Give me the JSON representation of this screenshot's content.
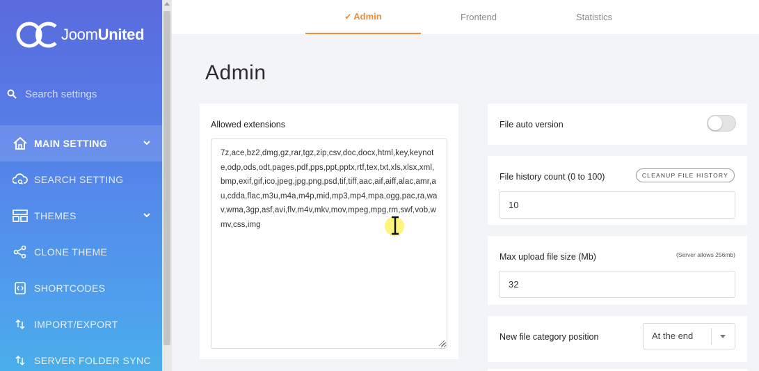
{
  "brand": {
    "logo_light": "Joom",
    "logo_bold": "United"
  },
  "search": {
    "placeholder": "Search settings"
  },
  "sidebar": {
    "items": [
      {
        "label": "MAIN SETTING",
        "icon": "home-icon",
        "active": true,
        "has_chevron": true
      },
      {
        "label": "SEARCH SETTING",
        "icon": "cloud-search-icon",
        "active": false,
        "has_chevron": false
      },
      {
        "label": "THEMES",
        "icon": "layout-icon",
        "active": false,
        "has_chevron": true
      },
      {
        "label": "CLONE THEME",
        "icon": "share-icon",
        "active": false,
        "has_chevron": false
      },
      {
        "label": "SHORTCODES",
        "icon": "code-icon",
        "active": false,
        "has_chevron": false
      },
      {
        "label": "IMPORT/EXPORT",
        "icon": "arrows-updown-icon",
        "active": false,
        "has_chevron": false
      },
      {
        "label": "SERVER FOLDER SYNC",
        "icon": "arrows-updown-icon",
        "active": false,
        "has_chevron": false
      }
    ]
  },
  "tabs": [
    {
      "label": "Admin",
      "active": true
    },
    {
      "label": "Frontend",
      "active": false
    },
    {
      "label": "Statistics",
      "active": false
    }
  ],
  "page": {
    "title": "Admin"
  },
  "allowed_extensions": {
    "label": "Allowed extensions",
    "value": "7z,ace,bz2,dmg,gz,rar,tgz,zip,csv,doc,docx,html,key,keynote,odp,ods,odt,pages,pdf,pps,ppt,pptx,rtf,tex,txt,xls,xlsx,xml,bmp,exif,gif,ico,jpeg,jpg,png,psd,tif,tiff,aac,aif,aiff,alac,amr,au,cdda,flac,m3u,m4a,m4p,mid,mp3,mp4,mpa,ogg,pac,ra,wav,wma,3gp,asf,avi,flv,m4v,mkv,mov,mpeg,mpg,rm,swf,vob,wmv,css,img"
  },
  "file_auto_version": {
    "label": "File auto version",
    "enabled": false
  },
  "file_history": {
    "label": "File history count (0 to 100)",
    "button": "CLEANUP FILE HISTORY",
    "value": "10"
  },
  "max_upload": {
    "label": "Max upload file size (Mb)",
    "hint": "(Server allows 256mb)",
    "value": "32"
  },
  "category_position": {
    "label": "New file category position",
    "selected": "At the end"
  },
  "colors": {
    "accent": "#f08c36",
    "sidebar_top": "#5a6bdd",
    "sidebar_bottom": "#4aaeea"
  }
}
